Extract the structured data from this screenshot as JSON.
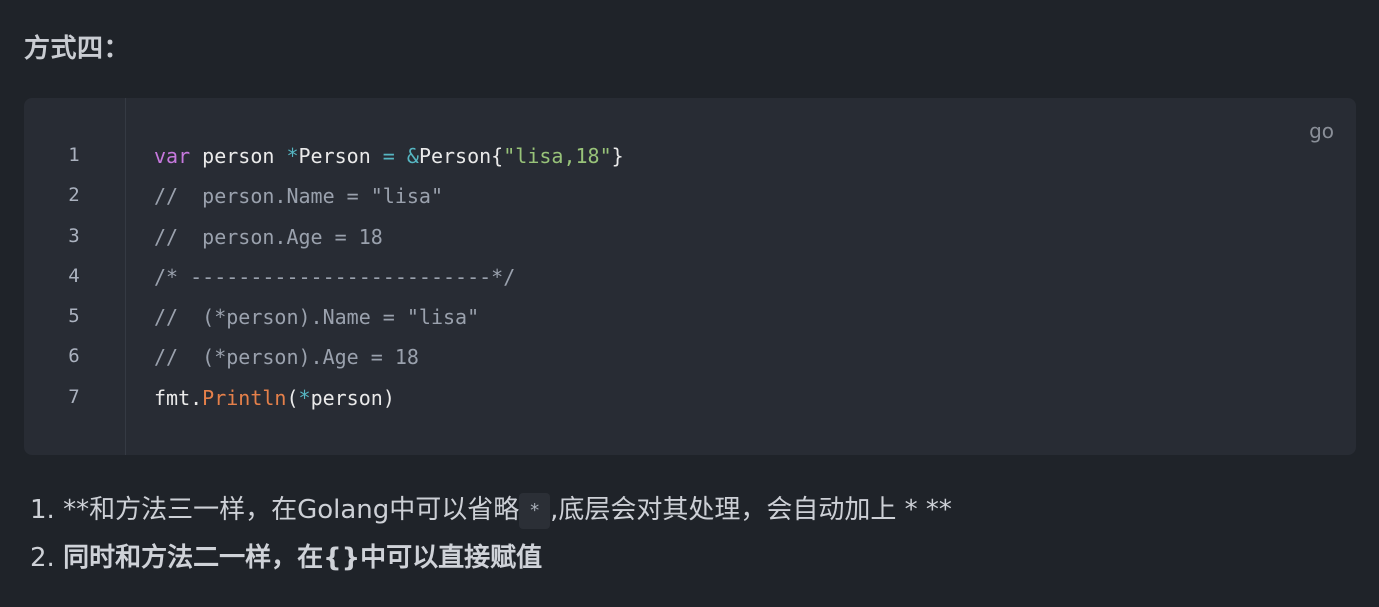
{
  "heading": "方式四：",
  "code_block": {
    "language": "go",
    "line_numbers": [
      "1",
      "2",
      "3",
      "4",
      "5",
      "6",
      "7"
    ],
    "line1": {
      "t1": "var",
      "t2": " person ",
      "t3": "*",
      "t4": "Person ",
      "t5": "=",
      "t6": " ",
      "t7": "&",
      "t8": "Person{",
      "t9": "\"lisa,18\"",
      "t10": "}"
    },
    "line2": "//  person.Name = \"lisa\"",
    "line3": "//  person.Age = 18",
    "line4": "/* -------------------------*/",
    "line5": "//  (*person).Name = \"lisa\"",
    "line6": "//  (*person).Age = 18",
    "line7": {
      "t1": "fmt.",
      "t2": "Println",
      "t3": "(",
      "t4": "*",
      "t5": "person",
      "t6": ")"
    }
  },
  "list": {
    "item1": {
      "number": "1.",
      "before": " **和方法三一样，在Golang中可以省略",
      "code": "*",
      "after": ",底层会对其处理，会自动加上 * **"
    },
    "item2": {
      "number": "2.",
      "text": "同时和方法二一样，在{}中可以直接赋值"
    }
  }
}
